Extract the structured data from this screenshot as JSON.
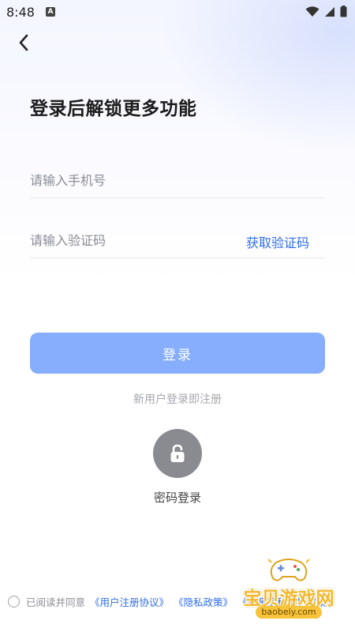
{
  "status_bar": {
    "time": "8:48",
    "notification_icon": "A",
    "icons": [
      "wifi-icon",
      "signal-icon",
      "battery-icon"
    ]
  },
  "nav": {
    "back_icon": "chevron-left-icon"
  },
  "title": "登录后解锁更多功能",
  "phone_field": {
    "placeholder": "请输入手机号",
    "value": ""
  },
  "code_field": {
    "placeholder": "请输入验证码",
    "value": "",
    "get_code_label": "获取验证码"
  },
  "login_button": {
    "label": "登录",
    "color": "#86aefc"
  },
  "register_hint": "新用户登录即注册",
  "password_login": {
    "label": "密码登录",
    "icon": "lock-icon"
  },
  "agreement": {
    "prefix": "已阅读并同意",
    "links": [
      "《用户注册协议》",
      "《隐私政策》",
      "《儿童隐私保护政策》"
    ],
    "checked": false
  },
  "watermark": {
    "text": "宝贝游戏网",
    "domain": "baobeiy.com"
  },
  "colors": {
    "accent": "#2f6de8",
    "button": "#86aefc",
    "text": "#1b1b1b"
  }
}
